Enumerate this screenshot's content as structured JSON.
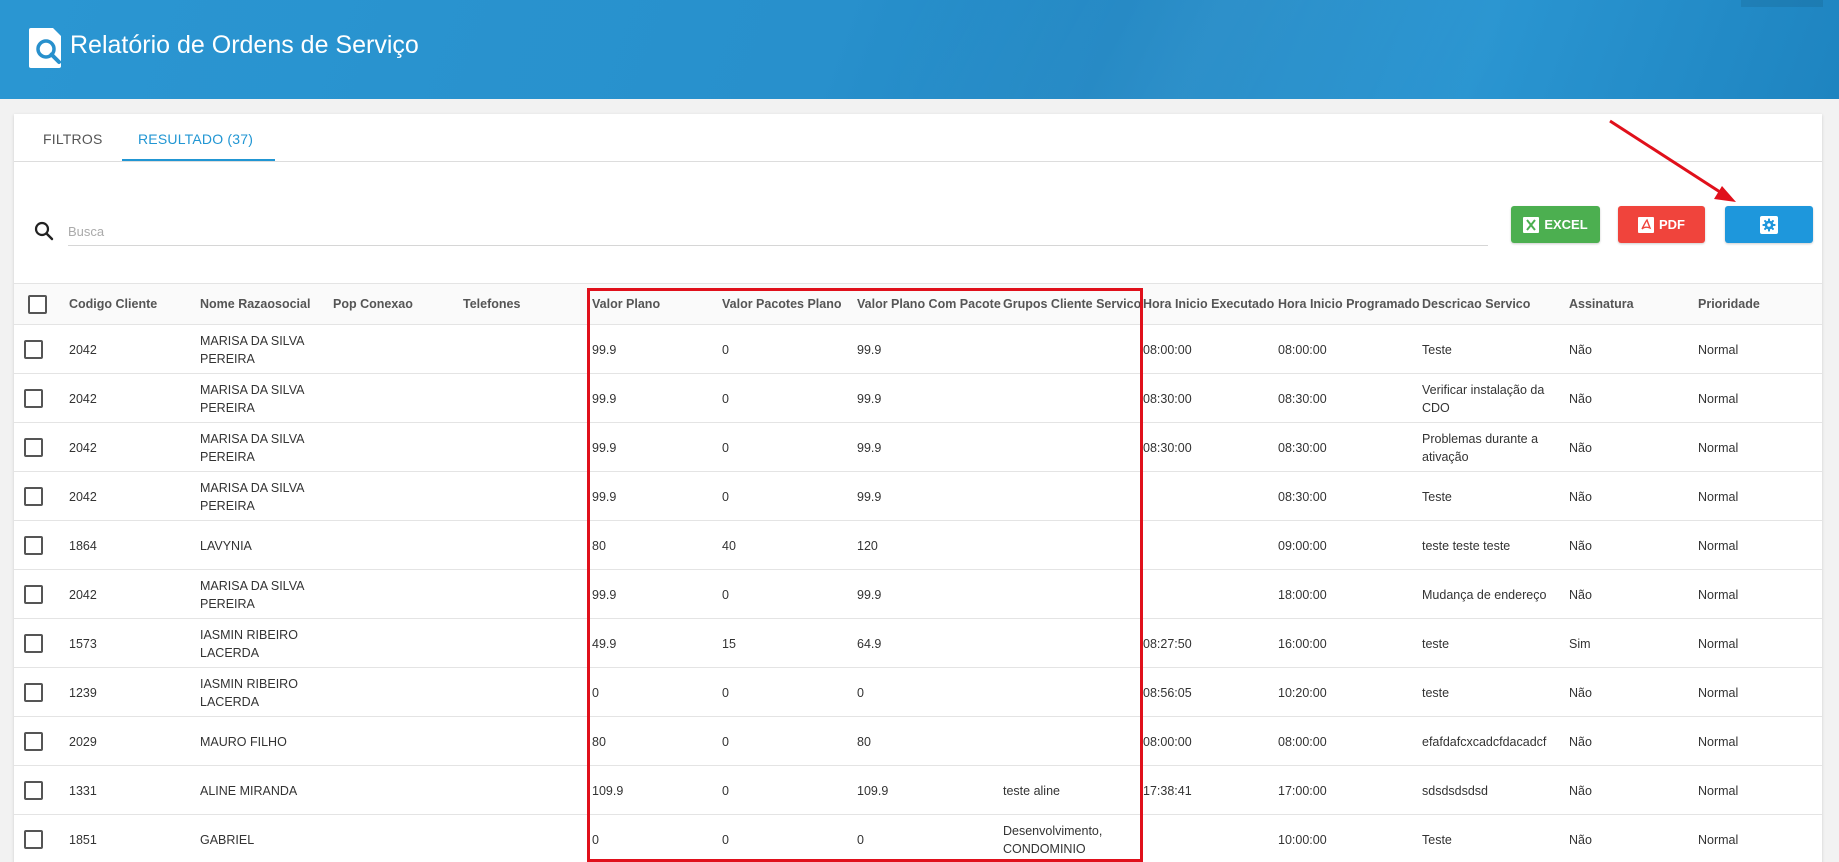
{
  "header": {
    "title": "Relatório de Ordens de Serviço",
    "icon": "search-document-icon"
  },
  "tabs": [
    {
      "label": "FILTROS"
    },
    {
      "label": "RESULTADO (37)"
    }
  ],
  "search": {
    "placeholder": "Busca",
    "value": ""
  },
  "toolbar": {
    "excel_label": "EXCEL",
    "pdf_label": "PDF",
    "settings_icon": "gear-icon"
  },
  "colors": {
    "header": "#2890cc",
    "accent": "#2196d3",
    "excel": "#4caf50",
    "pdf": "#f0443c",
    "settings": "#1e97dc",
    "annotation": "#e0101b"
  },
  "table": {
    "columns": [
      "Codigo Cliente",
      "Nome Razaosocial",
      "Pop Conexao",
      "Telefones",
      "Valor Plano",
      "Valor Pacotes Plano",
      "Valor Plano Com Pacote",
      "Grupos Cliente Servico",
      "Hora Inicio Executado",
      "Hora Inicio Programado",
      "Descricao Servico",
      "Assinatura",
      "Prioridade"
    ],
    "rows": [
      [
        "2042",
        "MARISA DA SILVA PEREIRA",
        "",
        "",
        "99.9",
        "0",
        "99.9",
        "",
        "08:00:00",
        "08:00:00",
        "Teste",
        "Não",
        "Normal"
      ],
      [
        "2042",
        "MARISA DA SILVA PEREIRA",
        "",
        "",
        "99.9",
        "0",
        "99.9",
        "",
        "08:30:00",
        "08:30:00",
        "Verificar instalação da CDO",
        "Não",
        "Normal"
      ],
      [
        "2042",
        "MARISA DA SILVA PEREIRA",
        "",
        "",
        "99.9",
        "0",
        "99.9",
        "",
        "08:30:00",
        "08:30:00",
        "Problemas durante a ativação",
        "Não",
        "Normal"
      ],
      [
        "2042",
        "MARISA DA SILVA PEREIRA",
        "",
        "",
        "99.9",
        "0",
        "99.9",
        "",
        "",
        "08:30:00",
        "Teste",
        "Não",
        "Normal"
      ],
      [
        "1864",
        "LAVYNIA",
        "",
        "",
        "80",
        "40",
        "120",
        "",
        "",
        "09:00:00",
        "teste teste teste",
        "Não",
        "Normal"
      ],
      [
        "2042",
        "MARISA DA SILVA PEREIRA",
        "",
        "",
        "99.9",
        "0",
        "99.9",
        "",
        "",
        "18:00:00",
        "Mudança de endereço",
        "Não",
        "Normal"
      ],
      [
        "1573",
        "IASMIN RIBEIRO LACERDA",
        "",
        "",
        "49.9",
        "15",
        "64.9",
        "",
        "08:27:50",
        "16:00:00",
        "teste",
        "Sim",
        "Normal"
      ],
      [
        "1239",
        "IASMIN RIBEIRO LACERDA",
        "",
        "",
        "0",
        "0",
        "0",
        "",
        "08:56:05",
        "10:20:00",
        "teste",
        "Não",
        "Normal"
      ],
      [
        "2029",
        "MAURO FILHO",
        "",
        "",
        "80",
        "0",
        "80",
        "",
        "08:00:00",
        "08:00:00",
        "efafdafcxcadcfdacadcf",
        "Não",
        "Normal"
      ],
      [
        "1331",
        "ALINE MIRANDA",
        "",
        "",
        "109.9",
        "0",
        "109.9",
        "teste aline",
        "17:38:41",
        "17:00:00",
        "sdsdsdsdsd",
        "Não",
        "Normal"
      ],
      [
        "1851",
        "GABRIEL",
        "",
        "",
        "0",
        "0",
        "0",
        "Desenvolvimento, CONDOMINIO",
        "",
        "10:00:00",
        "Teste",
        "Não",
        "Normal"
      ]
    ]
  }
}
